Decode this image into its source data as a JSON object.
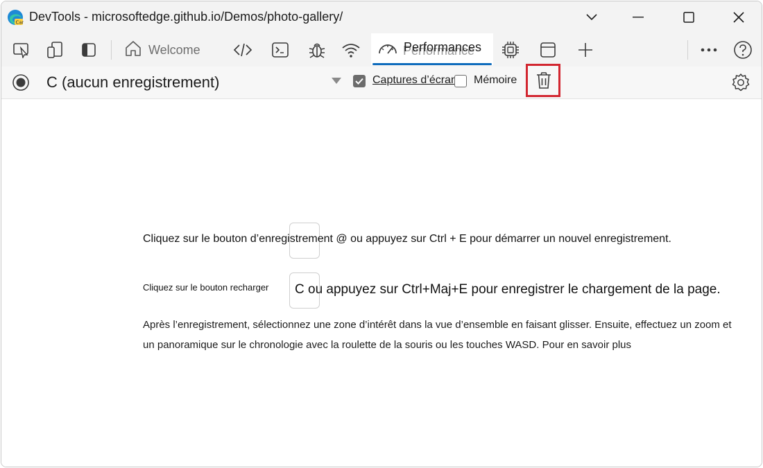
{
  "window": {
    "title": "DevTools - microsoftedge.github.io/Demos/photo-gallery/",
    "app_icon": "edge-canary-icon"
  },
  "tabs": {
    "welcome_label": "Welcome",
    "performance_label": "Performances",
    "performance_label_under": "Performance",
    "icons": [
      "inspect-icon",
      "device-emulation-icon",
      "dock-sidebar-icon",
      "home-icon",
      "elements-code-icon",
      "console-icon",
      "sources-bug-icon",
      "network-wifi-icon",
      "performance-gauge-icon",
      "memory-chip-icon",
      "application-window-icon",
      "add-tab-icon",
      "more-tools-icon",
      "help-icon"
    ]
  },
  "toolbar": {
    "session_label": "C (aucun enregistrement)",
    "screenshots_label": "Captures d’écran",
    "screenshots_checked": true,
    "memory_label": "Mémoire",
    "memory_checked": false,
    "highlight_color": "#d22630"
  },
  "main": {
    "line1": "Cliquez sur le bouton d’enregistrement @ ou appuyez sur Ctrl + E pour démarrer un nouvel enregistrement.",
    "line2_small": "Cliquez sur le bouton recharger",
    "line2_big": "C ou appuyez sur Ctrl+Maj+E pour enregistrer le chargement de la page.",
    "paragraph": "Après l’enregistrement, sélectionnez une zone d’intérêt dans la vue d’ensemble en faisant glisser. Ensuite, effectuez un zoom et un panoramique sur le chronologie avec la roulette de la souris ou les touches WASD. Pour en savoir plus"
  },
  "colors": {
    "accent": "#0f6cbd",
    "chrome_bg": "#f3f3f3"
  }
}
